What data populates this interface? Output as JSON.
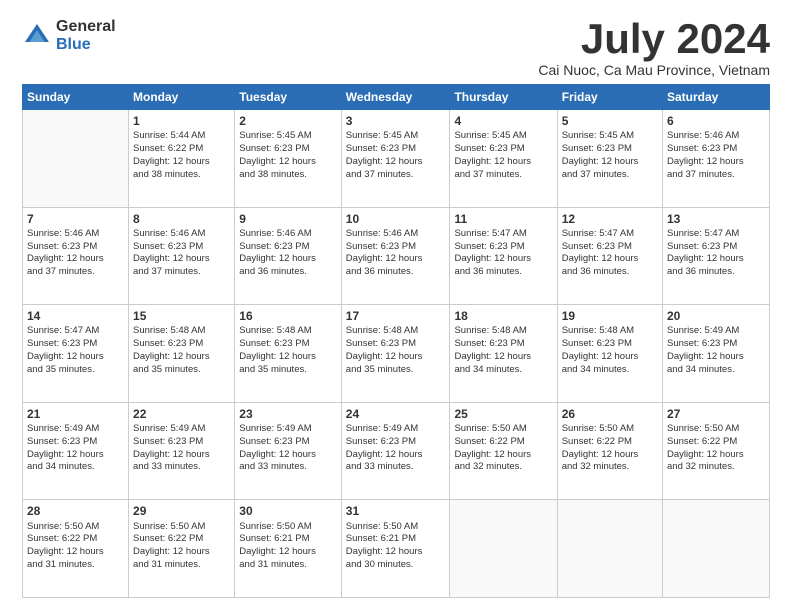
{
  "logo": {
    "general": "General",
    "blue": "Blue"
  },
  "title": "July 2024",
  "location": "Cai Nuoc, Ca Mau Province, Vietnam",
  "weekdays": [
    "Sunday",
    "Monday",
    "Tuesday",
    "Wednesday",
    "Thursday",
    "Friday",
    "Saturday"
  ],
  "weeks": [
    [
      {
        "day": "",
        "info": ""
      },
      {
        "day": "1",
        "info": "Sunrise: 5:44 AM\nSunset: 6:22 PM\nDaylight: 12 hours\nand 38 minutes."
      },
      {
        "day": "2",
        "info": "Sunrise: 5:45 AM\nSunset: 6:23 PM\nDaylight: 12 hours\nand 38 minutes."
      },
      {
        "day": "3",
        "info": "Sunrise: 5:45 AM\nSunset: 6:23 PM\nDaylight: 12 hours\nand 37 minutes."
      },
      {
        "day": "4",
        "info": "Sunrise: 5:45 AM\nSunset: 6:23 PM\nDaylight: 12 hours\nand 37 minutes."
      },
      {
        "day": "5",
        "info": "Sunrise: 5:45 AM\nSunset: 6:23 PM\nDaylight: 12 hours\nand 37 minutes."
      },
      {
        "day": "6",
        "info": "Sunrise: 5:46 AM\nSunset: 6:23 PM\nDaylight: 12 hours\nand 37 minutes."
      }
    ],
    [
      {
        "day": "7",
        "info": "Sunrise: 5:46 AM\nSunset: 6:23 PM\nDaylight: 12 hours\nand 37 minutes."
      },
      {
        "day": "8",
        "info": "Sunrise: 5:46 AM\nSunset: 6:23 PM\nDaylight: 12 hours\nand 37 minutes."
      },
      {
        "day": "9",
        "info": "Sunrise: 5:46 AM\nSunset: 6:23 PM\nDaylight: 12 hours\nand 36 minutes."
      },
      {
        "day": "10",
        "info": "Sunrise: 5:46 AM\nSunset: 6:23 PM\nDaylight: 12 hours\nand 36 minutes."
      },
      {
        "day": "11",
        "info": "Sunrise: 5:47 AM\nSunset: 6:23 PM\nDaylight: 12 hours\nand 36 minutes."
      },
      {
        "day": "12",
        "info": "Sunrise: 5:47 AM\nSunset: 6:23 PM\nDaylight: 12 hours\nand 36 minutes."
      },
      {
        "day": "13",
        "info": "Sunrise: 5:47 AM\nSunset: 6:23 PM\nDaylight: 12 hours\nand 36 minutes."
      }
    ],
    [
      {
        "day": "14",
        "info": "Sunrise: 5:47 AM\nSunset: 6:23 PM\nDaylight: 12 hours\nand 35 minutes."
      },
      {
        "day": "15",
        "info": "Sunrise: 5:48 AM\nSunset: 6:23 PM\nDaylight: 12 hours\nand 35 minutes."
      },
      {
        "day": "16",
        "info": "Sunrise: 5:48 AM\nSunset: 6:23 PM\nDaylight: 12 hours\nand 35 minutes."
      },
      {
        "day": "17",
        "info": "Sunrise: 5:48 AM\nSunset: 6:23 PM\nDaylight: 12 hours\nand 35 minutes."
      },
      {
        "day": "18",
        "info": "Sunrise: 5:48 AM\nSunset: 6:23 PM\nDaylight: 12 hours\nand 34 minutes."
      },
      {
        "day": "19",
        "info": "Sunrise: 5:48 AM\nSunset: 6:23 PM\nDaylight: 12 hours\nand 34 minutes."
      },
      {
        "day": "20",
        "info": "Sunrise: 5:49 AM\nSunset: 6:23 PM\nDaylight: 12 hours\nand 34 minutes."
      }
    ],
    [
      {
        "day": "21",
        "info": "Sunrise: 5:49 AM\nSunset: 6:23 PM\nDaylight: 12 hours\nand 34 minutes."
      },
      {
        "day": "22",
        "info": "Sunrise: 5:49 AM\nSunset: 6:23 PM\nDaylight: 12 hours\nand 33 minutes."
      },
      {
        "day": "23",
        "info": "Sunrise: 5:49 AM\nSunset: 6:23 PM\nDaylight: 12 hours\nand 33 minutes."
      },
      {
        "day": "24",
        "info": "Sunrise: 5:49 AM\nSunset: 6:23 PM\nDaylight: 12 hours\nand 33 minutes."
      },
      {
        "day": "25",
        "info": "Sunrise: 5:50 AM\nSunset: 6:22 PM\nDaylight: 12 hours\nand 32 minutes."
      },
      {
        "day": "26",
        "info": "Sunrise: 5:50 AM\nSunset: 6:22 PM\nDaylight: 12 hours\nand 32 minutes."
      },
      {
        "day": "27",
        "info": "Sunrise: 5:50 AM\nSunset: 6:22 PM\nDaylight: 12 hours\nand 32 minutes."
      }
    ],
    [
      {
        "day": "28",
        "info": "Sunrise: 5:50 AM\nSunset: 6:22 PM\nDaylight: 12 hours\nand 31 minutes."
      },
      {
        "day": "29",
        "info": "Sunrise: 5:50 AM\nSunset: 6:22 PM\nDaylight: 12 hours\nand 31 minutes."
      },
      {
        "day": "30",
        "info": "Sunrise: 5:50 AM\nSunset: 6:21 PM\nDaylight: 12 hours\nand 31 minutes."
      },
      {
        "day": "31",
        "info": "Sunrise: 5:50 AM\nSunset: 6:21 PM\nDaylight: 12 hours\nand 30 minutes."
      },
      {
        "day": "",
        "info": ""
      },
      {
        "day": "",
        "info": ""
      },
      {
        "day": "",
        "info": ""
      }
    ]
  ]
}
